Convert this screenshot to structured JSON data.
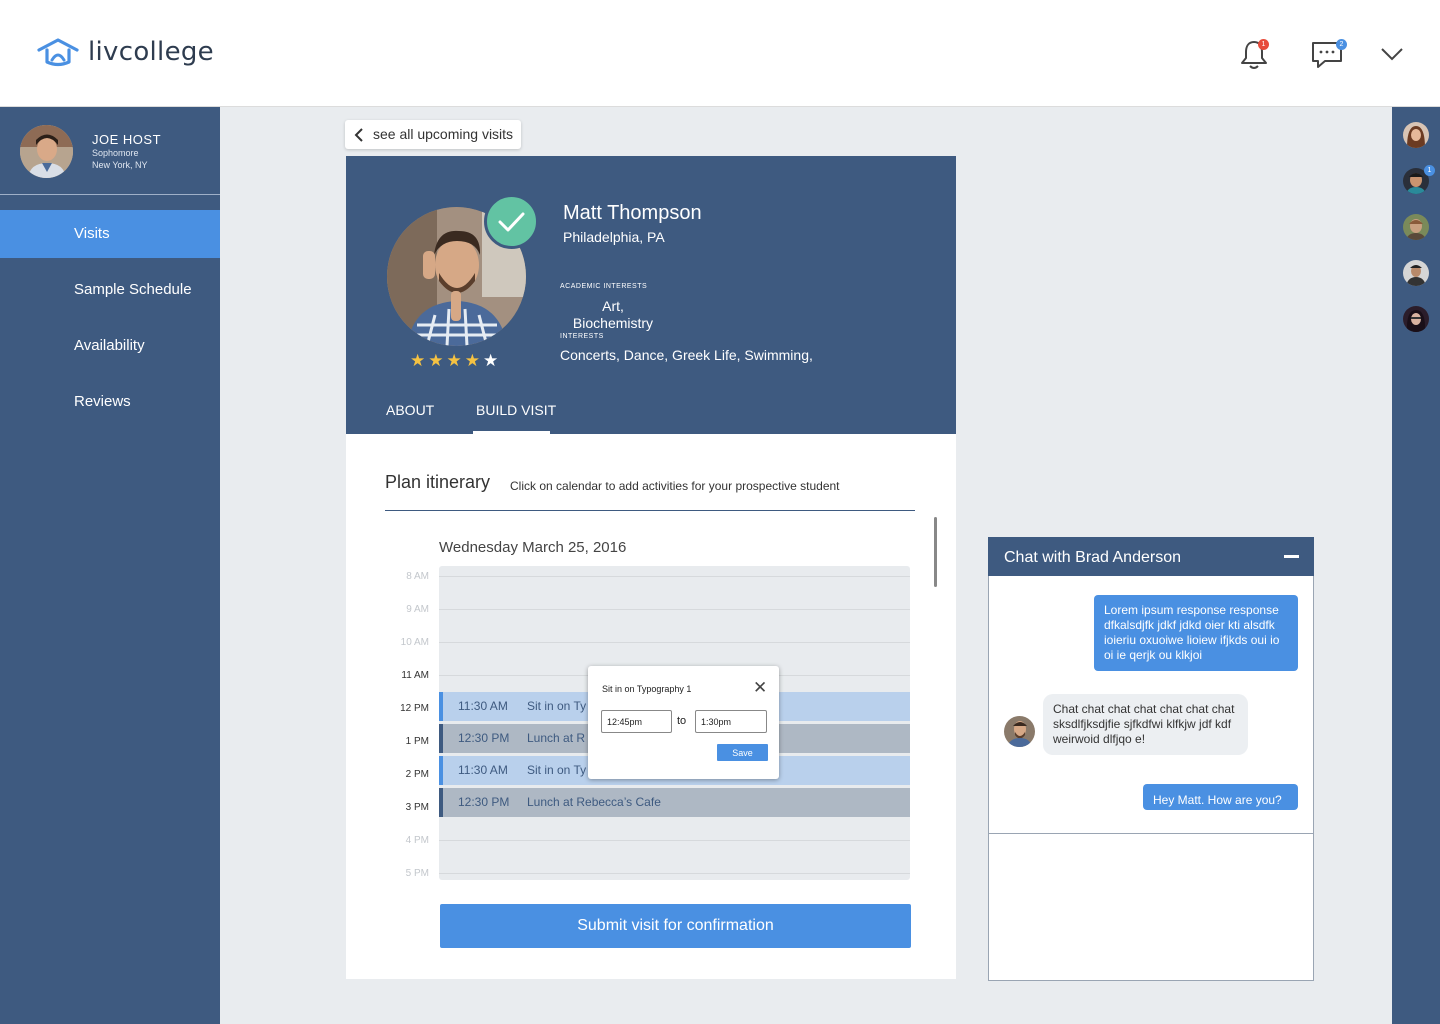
{
  "app": {
    "logo_text": "livcollege"
  },
  "header": {
    "notifications_count": "1",
    "messages_count": "2"
  },
  "profile": {
    "name": "JOE HOST",
    "year": "Sophomore",
    "location": "New York, NY"
  },
  "nav": {
    "items": [
      {
        "label": "Visits",
        "active": true
      },
      {
        "label": "Sample Schedule",
        "active": false
      },
      {
        "label": "Availability",
        "active": false
      },
      {
        "label": "Reviews",
        "active": false
      }
    ]
  },
  "rail": {
    "badge": "1"
  },
  "back_link": "see all upcoming visits",
  "student": {
    "name": "Matt Thompson",
    "location": "Philadelphia, PA",
    "rating": 4,
    "academic_label": "ACADEMIC INTERESTS",
    "academic_1": "Art,",
    "academic_2": "Biochemistry",
    "interests_label": "INTERESTS",
    "interests": "Concerts, Dance, Greek Life, Swimming,"
  },
  "tabs": [
    {
      "label": "ABOUT"
    },
    {
      "label": "BUILD VISIT"
    }
  ],
  "plan": {
    "title": "Plan itinerary",
    "subtitle": "Click on calendar to add activities for your prospective student",
    "date": "Wednesday March 25, 2016",
    "hours": [
      "8 AM",
      "9 AM",
      "10 AM",
      "11 AM",
      "12 PM",
      "1 PM",
      "2 PM",
      "3 PM",
      "4 PM",
      "5 PM"
    ],
    "events": [
      {
        "time": "11:30 AM",
        "title": "Sit in on Ty",
        "style": "blue"
      },
      {
        "time": "12:30 PM",
        "title": "Lunch at R",
        "style": "gray"
      },
      {
        "time": "11:30 AM",
        "title": "Sit in on Ty",
        "style": "blue"
      },
      {
        "time": "12:30 PM",
        "title": "Lunch at Rebecca’s Cafe",
        "style": "gray"
      }
    ],
    "submit_label": "Submit visit for confirmation"
  },
  "popup": {
    "title": "Sit in on Typography 1",
    "from": "12:45pm",
    "to_label": "to",
    "to": "1:30pm",
    "save_label": "Save"
  },
  "chat": {
    "title": "Chat with Brad Anderson",
    "messages": [
      {
        "from": "me",
        "text": "Lorem ipsum response response dfkalsdjfk jdkf jdkd oier kti alsdfk ioieriu oxuoiwe lioiew ifjkds oui io oi ie qerjk ou klkjoi"
      },
      {
        "from": "them",
        "text": "Chat chat chat chat chat chat chat sksdlfjksdjfie sjfkdfwi klfkjw jdf kdf weirwoid dlfjqo e!"
      },
      {
        "from": "me",
        "text": "Hey Matt. How are you?"
      }
    ]
  },
  "colors": {
    "primary": "#4a90e2",
    "navy": "#3e5a80",
    "check": "#62c3a3",
    "star": "#f5c242",
    "badge_red": "#e74c3c"
  }
}
